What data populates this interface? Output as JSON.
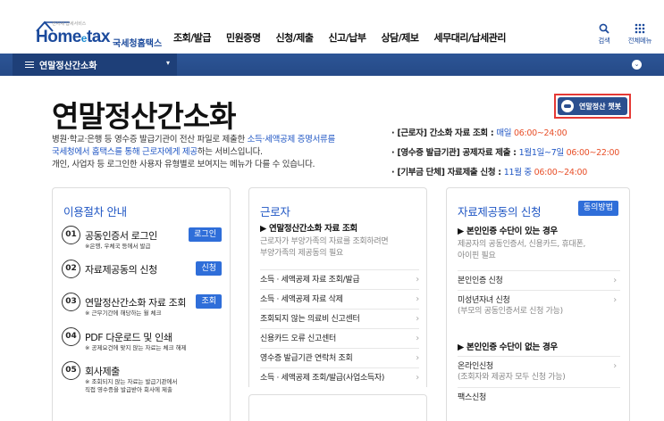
{
  "header": {
    "logo_main": "Home",
    "logo_e": "e",
    "logo_tax": "tax",
    "logo_ko": "국세청홈택스",
    "logo_tiny": "전자세 납세서비스",
    "nav": [
      "조회/발급",
      "민원증명",
      "신청/제출",
      "신고/납부",
      "상담/제보",
      "세무대리/납세관리"
    ],
    "search_label": "검색",
    "menu_label": "전체메뉴"
  },
  "menubar": {
    "current": "연말정산간소화",
    "dropdown": "▾",
    "circle": "⌄"
  },
  "page": {
    "title": "연말정산간소화",
    "intro_1a": "병원·학교·은행 등 영수증 발급기관이 전산 파일로 제출한 ",
    "intro_1b": "소득·세액공제 증명서류를",
    "intro_2a": "국세청에서 홈택스를 통해 근로자에게 제공",
    "intro_2b": "하는 서비스입니다.",
    "intro_3": "개인, 사업자 등 로그인한 사용자 유형별로 보여지는 메뉴가 다를 수 있습니다."
  },
  "schedule": {
    "l1_label": "· [근로자] 간소화 자료 조회 : ",
    "l1_a": "매일 ",
    "l1_b": "06:00~24:00",
    "l2_label": "· [영수증 발급기관] 공제자료 제출 : ",
    "l2_a": "1월1일~7일 ",
    "l2_b": "06:00~22:00",
    "l3_label": "· [기부금 단체] 자료제출 신청 : ",
    "l3_a": "11월 중 ",
    "l3_b": "06:00~24:00"
  },
  "chatbot": {
    "label": "연말정산 챗봇"
  },
  "guide": {
    "title": "이용절차 안내",
    "steps": [
      {
        "num": "01",
        "label": "공동인증서 로그인",
        "sub": "※은행, 우체국 등에서 발급",
        "btn": "로그인"
      },
      {
        "num": "02",
        "label": "자료제공동의 신청",
        "sub": "",
        "btn": "신청"
      },
      {
        "num": "03",
        "label": "연말정산간소화 자료 조회",
        "sub": "※ 근무기간에 해당하는 월 체크",
        "btn": "조회"
      },
      {
        "num": "04",
        "label": "PDF 다운로드 및 인쇄",
        "sub": "※ 공제요건에 맞지 않는 자료는 체크 해제",
        "btn": ""
      },
      {
        "num": "05",
        "label": "회사제출",
        "sub": "※ 조회되지 않는 자료는 발급기관에서",
        "sub2": "직접 영수증을 발급받아 회사에 제출",
        "btn": ""
      }
    ]
  },
  "worker": {
    "title": "근로자",
    "section": "▶ 연말정산간소화 자료 조회",
    "desc_1": "근로자가 부양가족의 자료를 조회하려면",
    "desc_2": "부양가족의 제공동의 필요",
    "items": [
      "소득 · 세액공제 자료 조회/발급",
      "소득 · 세액공제 자료 삭제",
      "조회되지 않는 의료비 신고센터",
      "신용카드 오류 신고센터",
      "영수증 발급기관 연락처 조회",
      "소득 · 세액공제 조회/발급(사업소득자)"
    ]
  },
  "consent": {
    "title": "자료제공동의 신청",
    "agree_btn": "동의방법",
    "sec1": "▶ 본인인증 수단이 있는 경우",
    "desc_1": "제공자의 공동인증서, 신용카드, 휴대폰,",
    "desc_2": "아이핀 필요",
    "r1": "본인인증 신청",
    "r2": "미성년자녀 신청",
    "r2_sub": "(부모의 공동인증서로 신청 가능)",
    "sec2": "▶ 본인인증 수단이 없는 경우",
    "r3": "온라인신청",
    "r3_sub": "(조회자와 제공자 모두 신청 가능)",
    "r4": "팩스신청"
  },
  "colors": {
    "brand": "#1b4a9c",
    "accent": "#1f56c4",
    "button": "#2f6ed9",
    "highlight_red": "#e8502a",
    "chatbot_border": "#e53935"
  }
}
